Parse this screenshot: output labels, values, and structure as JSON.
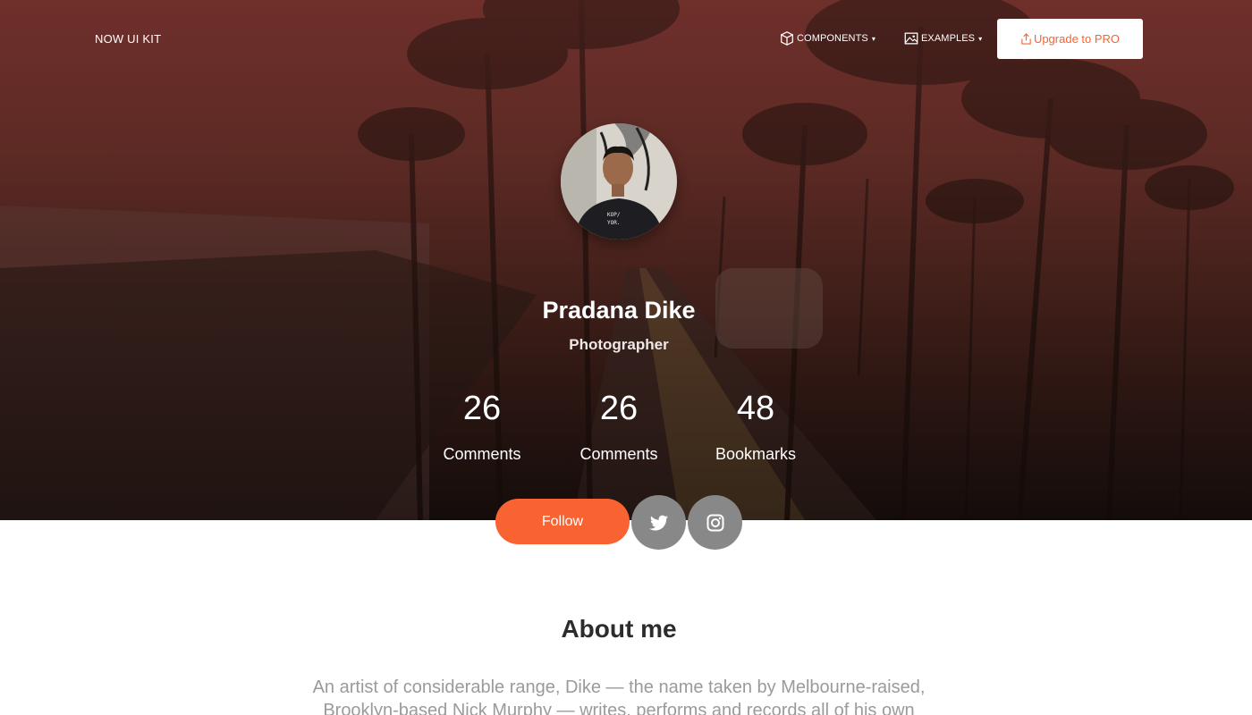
{
  "navbar": {
    "brand": "NOW UI KIT",
    "components_label": "COMPONENTS",
    "examples_label": "EXAMPLES",
    "upgrade_label": "Upgrade to PRO"
  },
  "profile": {
    "name": "Pradana Dike",
    "role": "Photographer",
    "stats": [
      {
        "value": "26",
        "label": "Comments"
      },
      {
        "value": "26",
        "label": "Comments"
      },
      {
        "value": "48",
        "label": "Bookmarks"
      }
    ],
    "follow_label": "Follow",
    "social": [
      "twitter-icon",
      "instagram-icon"
    ]
  },
  "about": {
    "title": "About me",
    "text": "An artist of considerable range, Dike — the name taken by Melbourne-raised, Brooklyn-based Nick Murphy — writes, performs and records all of his own"
  },
  "colors": {
    "accent": "#f96332",
    "social_button": "#888888",
    "hero_tint": "#6a2e2a"
  }
}
